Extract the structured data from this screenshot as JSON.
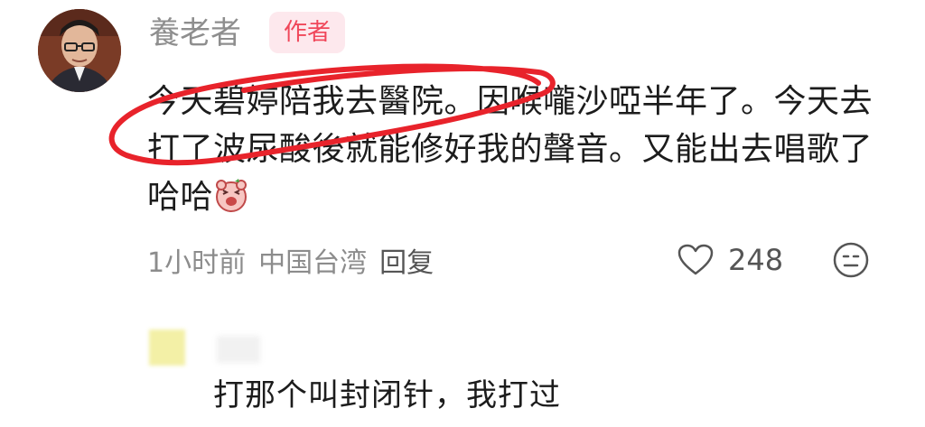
{
  "comment": {
    "username": "養老者",
    "author_badge": "作者",
    "text": "今天碧婷陪我去醫院。因喉嚨沙啞半年了。今天去打了波尿酸後就能修好我的聲音。又能出去唱歌了哈哈",
    "emoji": "laughing-bear-emoji",
    "time": "1小时前",
    "location": "中国台湾",
    "reply_label": "回复",
    "like_count": "248",
    "annotation_color": "#e8232b"
  },
  "reply": {
    "text": "打那个叫封闭针，我打过"
  },
  "colors": {
    "badge_text": "#f0475a",
    "badge_bg": "#fde8ed",
    "meta": "#8c8c8c"
  }
}
